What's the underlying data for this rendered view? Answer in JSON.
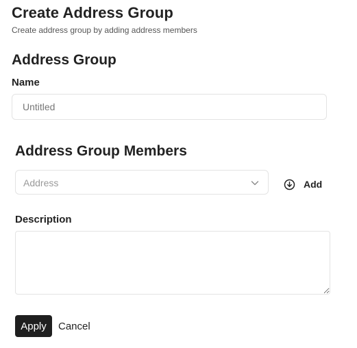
{
  "header": {
    "title": "Create Address Group",
    "subtitle": "Create address group by adding address members"
  },
  "address_group": {
    "section_title": "Address Group",
    "name_label": "Name",
    "name_placeholder": "Untitled",
    "name_value": ""
  },
  "members": {
    "section_title": "Address Group Members",
    "address_placeholder": "Address",
    "add_label": "Add",
    "add_icon": "circle-arrow-down-icon",
    "chevron_icon": "chevron-down-icon"
  },
  "description": {
    "label": "Description",
    "value": ""
  },
  "actions": {
    "apply_label": "Apply",
    "cancel_label": "Cancel"
  },
  "colors": {
    "primary_button": "#1f1f1f",
    "border": "#e3e3e3"
  }
}
